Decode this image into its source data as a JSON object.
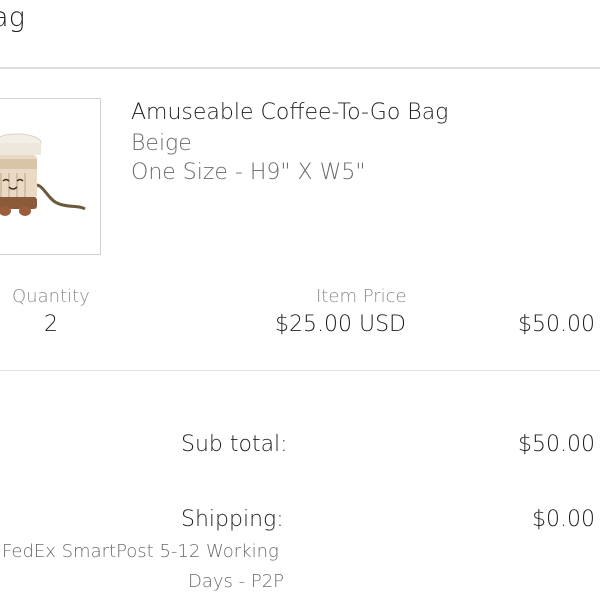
{
  "header": {
    "title": "ag"
  },
  "item": {
    "name": "Amuseable Coffee-To-Go Bag",
    "color": "Beige",
    "size": "One Size - H9\" X W5\"",
    "image_icon": "coffee-cup-plush-bag",
    "quantity_label": "Quantity",
    "quantity_value": "2",
    "price_label": "Item Price",
    "price_value": "$25.00 USD",
    "line_total": "$50.00"
  },
  "totals": {
    "subtotal_label": "Sub total:",
    "subtotal_value": "$50.00",
    "shipping_label": "Shipping:",
    "shipping_value": "$0.00",
    "shipping_method_line1": "FedEx SmartPost 5-12 Working",
    "shipping_method_line2": "Days - P2P"
  }
}
